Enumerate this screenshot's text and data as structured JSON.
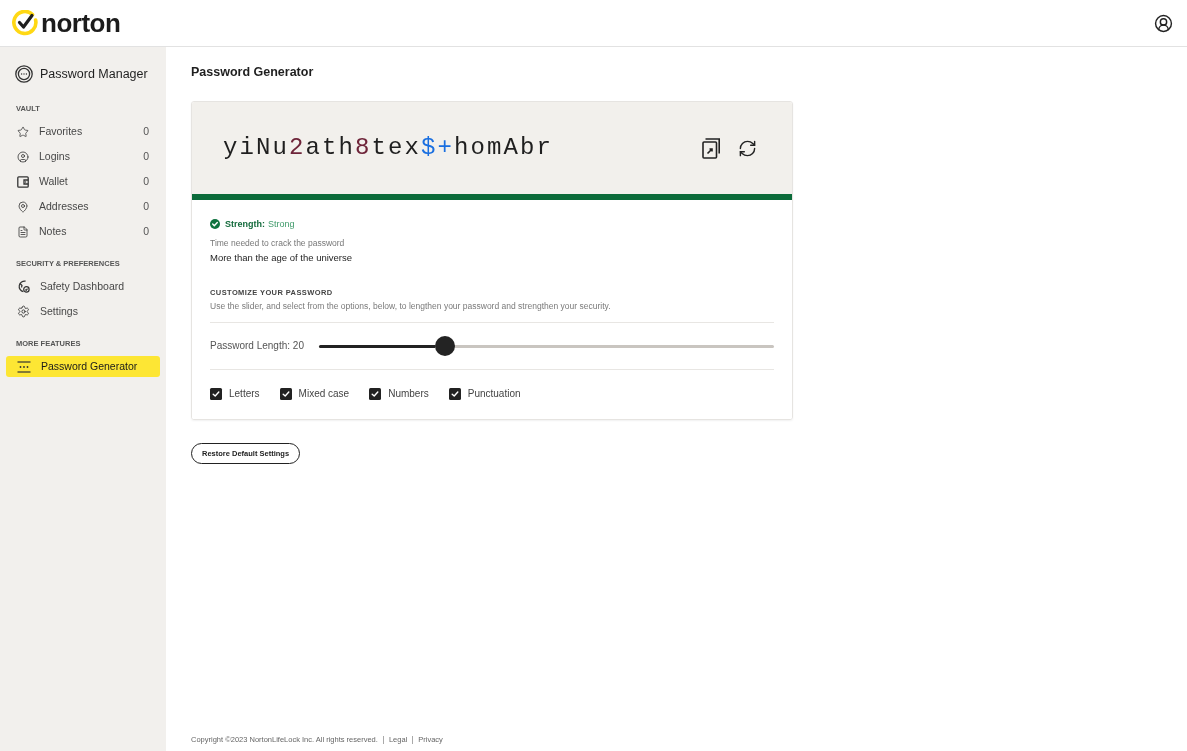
{
  "header": {
    "logo": "norton"
  },
  "sidebar": {
    "title": "Password Manager",
    "sections": [
      {
        "heading": "VAULT",
        "items": [
          {
            "label": "Favorites",
            "count": "0",
            "selected": false
          },
          {
            "label": "Logins",
            "count": "0",
            "selected": false
          },
          {
            "label": "Wallet",
            "count": "0",
            "selected": false
          },
          {
            "label": "Addresses",
            "count": "0",
            "selected": false
          },
          {
            "label": "Notes",
            "count": "0",
            "selected": false
          }
        ]
      },
      {
        "heading": "SECURITY & PREFERENCES",
        "items": [
          {
            "label": "Safety Dashboard",
            "selected": false
          },
          {
            "label": "Settings",
            "selected": false
          }
        ]
      },
      {
        "heading": "MORE FEATURES",
        "items": [
          {
            "label": "Password Generator",
            "selected": true
          }
        ]
      }
    ]
  },
  "page_title": "Password Generator",
  "generator": {
    "password": [
      {
        "text": "yiNu",
        "kind": "letter"
      },
      {
        "text": "2",
        "kind": "number"
      },
      {
        "text": "ath",
        "kind": "letter"
      },
      {
        "text": "8",
        "kind": "number"
      },
      {
        "text": "tex",
        "kind": "letter"
      },
      {
        "text": "$+",
        "kind": "symbol"
      },
      {
        "text": "homAbr",
        "kind": "letter"
      }
    ],
    "strength": {
      "label": "Strength:",
      "value": "Strong",
      "level": 1
    },
    "crack_time_label": "Time needed to crack the password",
    "crack_time": "More than the age of the universe",
    "customize": {
      "heading": "CUSTOMIZE YOUR PASSWORD",
      "description": "Use the slider, and select from the options, below, to lengthen your password and strengthen your security."
    },
    "length": {
      "label": "Password Length: 20",
      "level": 0.277
    },
    "options": [
      {
        "label": "Letters",
        "checked": true
      },
      {
        "label": "Mixed case",
        "checked": true
      },
      {
        "label": "Numbers",
        "checked": true
      },
      {
        "label": "Punctuation",
        "checked": true
      }
    ]
  },
  "restore_button": "Restore Default Settings",
  "footer": {
    "copyright": "Copyright ©2023 NortonLifeLock Inc. All rights reserved.",
    "links": [
      "Legal",
      "Privacy"
    ]
  }
}
